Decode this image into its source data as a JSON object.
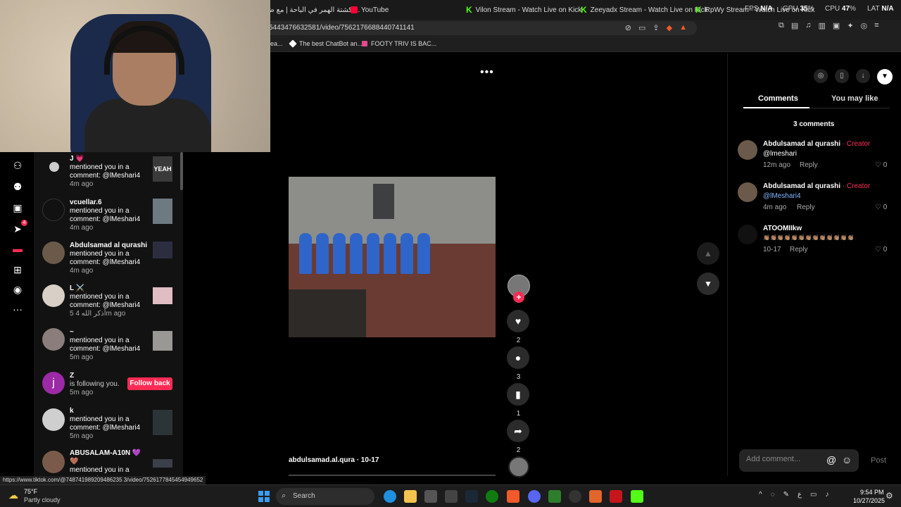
{
  "tabs": [
    {
      "label": "كشتة الهمر في الباحة | مع ضيف ...",
      "icon": ""
    },
    {
      "label": "YouTube",
      "icon": "youtube-icon"
    },
    {
      "label": "Vilon Stream - Watch Live on Kick",
      "icon": "kick-icon"
    },
    {
      "label": "Zeeyadx Stream - Watch Live on Kick",
      "icon": "kick-icon"
    },
    {
      "label": "RpWy Stream - Watch Live on Kick",
      "icon": "kick-icon"
    }
  ],
  "perf": {
    "fps_label": "FPS",
    "fps_value": "N/A",
    "gpu_label": "GPU",
    "gpu_value": "35",
    "gpu_unit": "%",
    "cpu_label": "CPU",
    "cpu_value": "47",
    "cpu_unit": "%",
    "lat_label": "LAT",
    "lat_value": "N/A"
  },
  "url": "5443476632581/video/7562176688440741141",
  "bookmarks": [
    {
      "label": "ea...",
      "icon": ""
    },
    {
      "label": "The best ChatBot an...",
      "icon": "diamond-icon"
    },
    {
      "label": "FOOTY TRIV IS BAC...",
      "icon": "bookmark-icon"
    }
  ],
  "notifications": [
    {
      "name": "J 💗",
      "text": "mentioned you in a comment: @lMeshari4",
      "time": "4m ago",
      "thumb": "YEAH"
    },
    {
      "name": "vcuellar.6",
      "text": "mentioned you in a comment: @lMeshari4",
      "time": "4m ago",
      "thumb": ""
    },
    {
      "name": "Abdulsamad al qurashi",
      "text": "mentioned you in a comment: @lMeshari4",
      "time": "4m ago",
      "thumb": ""
    },
    {
      "name": "L ⚔️",
      "text": "mentioned you in a comment: @lMeshari4",
      "time": "5 أذكر الله 4m ago",
      "thumb": ""
    },
    {
      "name": "~",
      "text": "mentioned you in a comment: @lMeshari4",
      "time": "5m ago",
      "thumb": ""
    },
    {
      "name": "Z",
      "text": "is following you.",
      "time": "5m ago",
      "follow_label": "Follow back",
      "avatar_letter": "j"
    },
    {
      "name": "k",
      "text": "mentioned you in a comment: @lMeshari4",
      "time": "5m ago",
      "thumb": ""
    },
    {
      "name": "ABUSALAM-A10N 💜 🤎",
      "text": "mentioned you in a comment:",
      "time": "",
      "thumb": ""
    }
  ],
  "video": {
    "more": "•••",
    "caption": "abdulsamad.al.qura · 10-17"
  },
  "actions": {
    "likes": "2",
    "comments": "3",
    "saves": "1",
    "shares": "2"
  },
  "sidebar": {
    "tab_comments": "Comments",
    "tab_you_may_like": "You may like",
    "comment_count": "3 comments",
    "comments": [
      {
        "name": "Abdulsamad al qurashi",
        "creator": "· Creator",
        "body": "@lmeshari",
        "mention": false,
        "time": "12m ago",
        "reply": "Reply",
        "likes": "0"
      },
      {
        "name": "Abdulsamad al qurashi",
        "creator": "· Creator",
        "body": "@lMeshari4",
        "mention": true,
        "time": "4m ago",
        "reply": "Reply",
        "likes": "0"
      },
      {
        "name": "ATOOMIIkw",
        "creator": "",
        "body": "👏🏽👏🏽👏🏽👏🏽👏🏽👏🏽👏🏽👏🏽👏🏽👏🏽👏🏽👏🏽👏🏽",
        "mention": false,
        "time": "10-17",
        "reply": "Reply",
        "likes": "0"
      }
    ],
    "add_placeholder": "Add comment...",
    "post_label": "Post"
  },
  "status_url": "https://www.tiktok.com/@748741989209486235 3/video/7526177845454949652",
  "taskbar": {
    "temp": "75°F",
    "weather": "Partly cloudy",
    "search": "Search",
    "tray_lang": "ع",
    "time": "9:54 PM",
    "date": "10/27/2025"
  },
  "colors": {
    "accent": "#fe2c55",
    "kick": "#53fc18",
    "mention": "#7fb6ff"
  }
}
